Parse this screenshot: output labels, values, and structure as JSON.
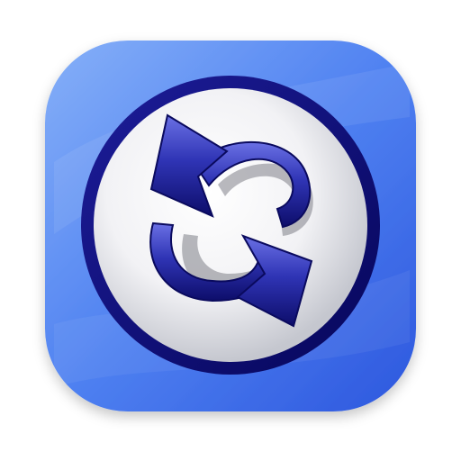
{
  "icon": {
    "name": "sync-arrows-app-icon",
    "glyph": "refresh-icon",
    "colors": {
      "tile_light": "#7faaf7",
      "tile_mid": "#4d7ff0",
      "tile_dark": "#2f5be0",
      "disc_white": "#ffffff",
      "disc_shade": "#c9cbd3",
      "ring_navy": "#0b0b7a",
      "arrow_light": "#5a5fd8",
      "arrow_dark": "#12127a",
      "shadow_gray": "#7f8088"
    }
  }
}
